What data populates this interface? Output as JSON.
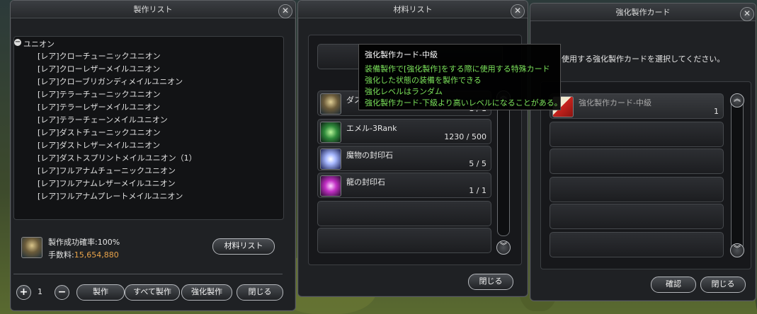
{
  "left_panel": {
    "title": "製作リスト",
    "tree_root": "ユニオン",
    "items": [
      "[レア]クローチューニックユニオン",
      "[レア]クローレザーメイルユニオン",
      "[レア]クローブリガンディメイルユニオン",
      "[レア]テラーチューニックユニオン",
      "[レア]テラーレザーメイルユニオン",
      "[レア]テラーチェーンメイルユニオン",
      "[レア]ダストチューニックユニオン",
      "[レア]ダストレザーメイルユニオン",
      "[レア]ダストスプリントメイルユニオン（1）",
      "[レア]フルアナムチューニックユニオン",
      "[レア]フルアナムレザーメイルユニオン",
      "[レア]フルアナムプレートメイルユニオン"
    ],
    "success_rate": "製作成功確率:100%",
    "fee_label": "手数料:",
    "fee_value": "15,654,880",
    "material_list_button": "材料リスト",
    "quantity": "1",
    "craft_button": "製作",
    "craft_all_button": "すべて製作",
    "enhance_craft_button": "強化製作",
    "close_button": "閉じる"
  },
  "middle_panel": {
    "title": "材料リスト",
    "materials": [
      {
        "name": "ダス",
        "qty": "1 / 1"
      },
      {
        "name": "エメル-3Rank",
        "qty": "1230 / 500"
      },
      {
        "name": "魔物の封印石",
        "qty": "5 / 5"
      },
      {
        "name": "龍の封印石",
        "qty": "1 / 1"
      }
    ],
    "close_button": "閉じる"
  },
  "right_panel": {
    "title": "強化製作カード",
    "instruction": "使用する強化製作カードを選択してください。",
    "card_name": "強化製作カード-中級",
    "card_qty": "1",
    "confirm_button": "確認",
    "close_button": "閉じる"
  },
  "tooltip": {
    "title": "強化製作カード-中級",
    "lines": [
      "装備製作で[強化製作]をする際に使用する特殊カード",
      "強化した状態の装備を製作できる",
      "強化レベルはランダム",
      "強化製作カード-下級より高いレベルになることがある。"
    ]
  },
  "colors": {
    "fee_value": "#e8a34a",
    "tooltip_text": "#7be25a",
    "panel_bg": "#1f2124"
  }
}
